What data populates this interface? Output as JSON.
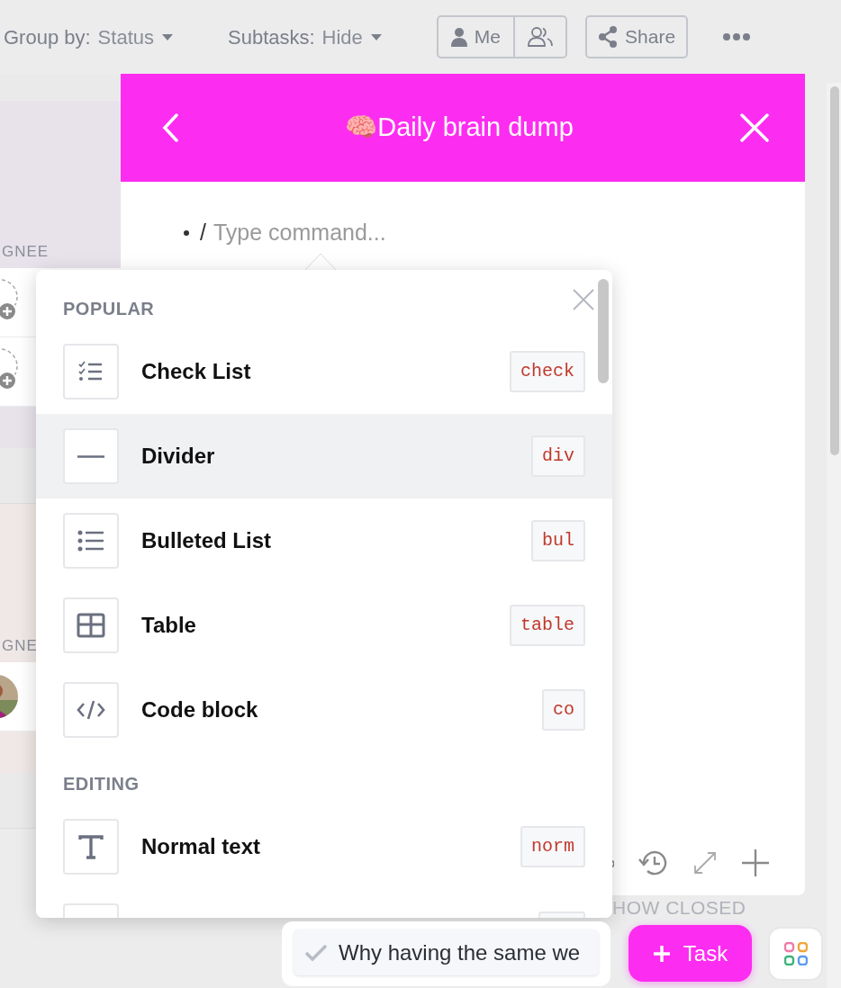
{
  "toolbar": {
    "group_by": {
      "label": "Group by:",
      "value": "Status"
    },
    "subtasks": {
      "label": "Subtasks:",
      "value": "Hide"
    },
    "me": "Me",
    "share": "Share"
  },
  "background": {
    "groups": [
      {
        "header": "GNEE",
        "rows": [
          {
            "kind": "empty"
          },
          {
            "kind": "empty"
          }
        ]
      },
      {
        "header": "GNE"
      }
    ],
    "show_closed": "HOW CLOSED"
  },
  "doc": {
    "title": "🧠Daily brain dump",
    "slash": "/",
    "placeholder": "Type command..."
  },
  "menu": {
    "sections": [
      {
        "title": "POPULAR",
        "items": [
          {
            "kind": "checklist",
            "label": "Check List",
            "shortcut": "check",
            "selected": false
          },
          {
            "kind": "divider",
            "label": "Divider",
            "shortcut": "div",
            "selected": true
          },
          {
            "kind": "bullets",
            "label": "Bulleted List",
            "shortcut": "bul",
            "selected": false
          },
          {
            "kind": "table",
            "label": "Table",
            "shortcut": "table",
            "selected": false
          },
          {
            "kind": "code",
            "label": "Code block",
            "shortcut": "co",
            "selected": false
          }
        ]
      },
      {
        "title": "EDITING",
        "items": [
          {
            "kind": "text",
            "label": "Normal text",
            "shortcut": "norm",
            "selected": false
          },
          {
            "kind": "blank",
            "selected": false
          }
        ]
      }
    ]
  },
  "pinned_task": {
    "text": "Why having the same we"
  },
  "add_task": {
    "label": "Task"
  }
}
